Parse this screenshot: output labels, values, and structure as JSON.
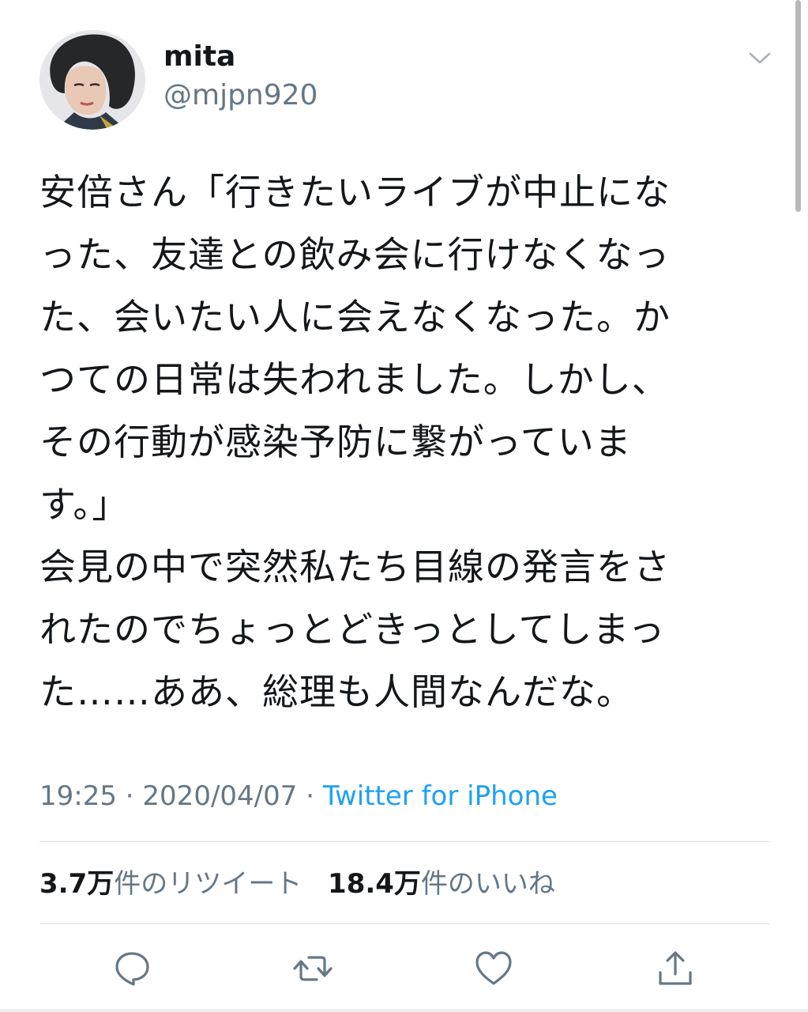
{
  "user": {
    "display_name": "mita",
    "handle": "@mjpn920"
  },
  "icons": {
    "avatar": "user-photo",
    "menu": "chevron-down-icon",
    "reply": "reply-bubble-icon",
    "retweet": "retweet-arrows-icon",
    "like": "heart-icon",
    "share": "share-upload-icon"
  },
  "tweet": {
    "lines": [
      "安倍さん「行きたいライブが中止にな",
      "った、友達との飲み会に行けなくなっ",
      "た、会いたい人に会えなくなった。か",
      "つての日常は失われました。しかし、",
      "その行動が感染予防に繋がっていま",
      "す。」",
      "会見の中で突然私たち目線の発言をさ",
      "れたのでちょっとどきっとしてしまっ",
      "た……ああ、総理も人間なんだな。"
    ]
  },
  "meta": {
    "time": "19:25",
    "date": "2020/04/07",
    "separator": " · ",
    "source": "Twitter for iPhone"
  },
  "stats": {
    "retweets_count": "3.7万",
    "retweets_label": "件のリツイート",
    "likes_count": "18.4万",
    "likes_label": "件のいいね"
  },
  "colors": {
    "text": "#14171a",
    "secondary": "#657786",
    "link": "#1da1f2",
    "divider": "#d9dfe3",
    "icon": "#657786"
  }
}
